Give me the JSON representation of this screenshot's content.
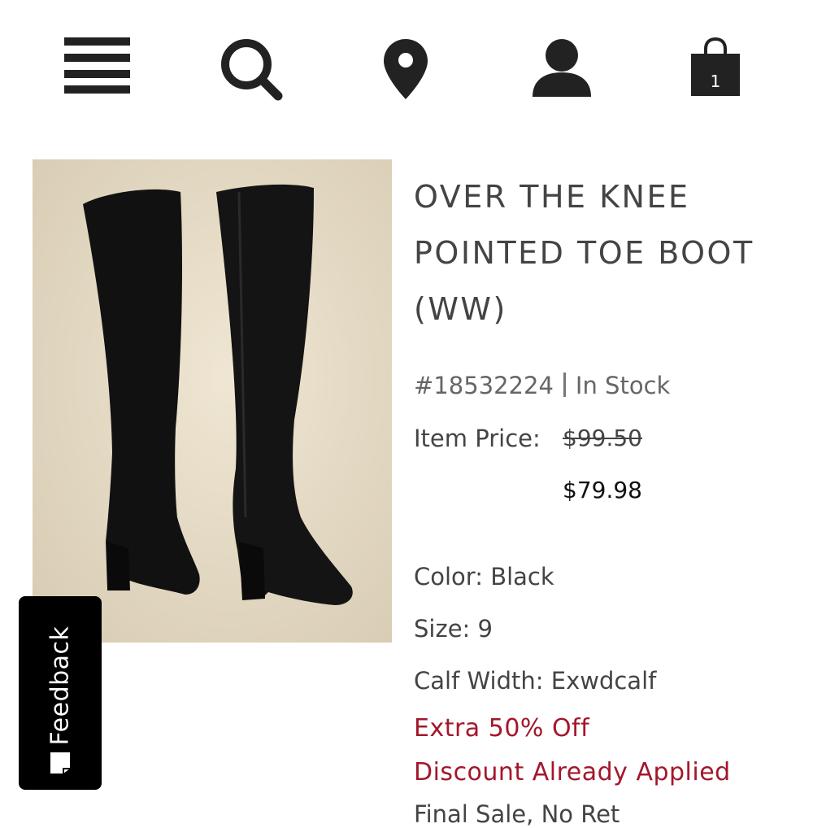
{
  "header": {
    "icons": [
      "menu-icon",
      "search-icon",
      "location-pin-icon",
      "account-icon",
      "shopping-bag-icon"
    ],
    "cart_count": "1"
  },
  "product": {
    "title": "OVER THE KNEE POINTED TOE BOOT (WW)",
    "sku": "#18532224",
    "stock_status": "In Stock",
    "price_label": "Item Price:",
    "original_price": "$99.50",
    "sale_price": "$79.98",
    "color_label": "Color:",
    "color_value": "Black",
    "size_label": "Size:",
    "size_value": "9",
    "calf_label": "Calf Width:",
    "calf_value": "Exwdcalf",
    "promo_line_1": "Extra 50% Off",
    "promo_line_2": "Discount Already Applied",
    "cutoff_text": "Final Sale, No Ret"
  },
  "feedback": {
    "label": "Feedback"
  },
  "colors": {
    "promo": "#a3172b",
    "icon": "#222222",
    "image_bg": "#e8e0cf"
  }
}
